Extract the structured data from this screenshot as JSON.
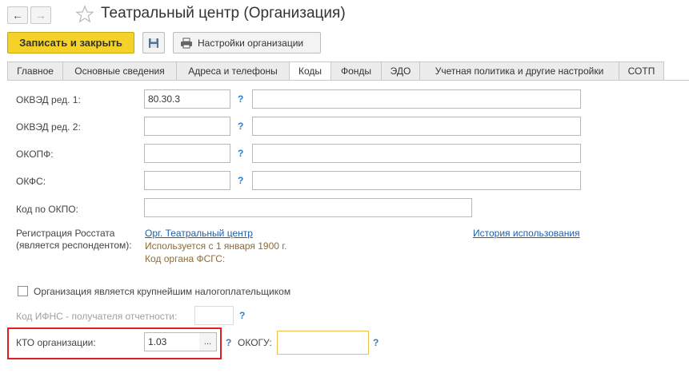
{
  "window": {
    "title": "Театральный центр (Организация)"
  },
  "toolbar": {
    "save_close_label": "Записать и закрыть",
    "settings_label": "Настройки организации"
  },
  "tabs": [
    {
      "label": "Главное"
    },
    {
      "label": "Основные сведения"
    },
    {
      "label": "Адреса и телефоны"
    },
    {
      "label": "Коды",
      "active": true
    },
    {
      "label": "Фонды"
    },
    {
      "label": "ЭДО"
    },
    {
      "label": "Учетная политика и другие настройки"
    },
    {
      "label": "СОТП"
    }
  ],
  "form": {
    "okved1": {
      "label": "ОКВЭД ред. 1:",
      "value": "80.30.3"
    },
    "okved2": {
      "label": "ОКВЭД ред. 2:",
      "value": ""
    },
    "okopf": {
      "label": "ОКОПФ:",
      "value": ""
    },
    "okfs": {
      "label": "ОКФС:",
      "value": ""
    },
    "okpo": {
      "label": "Код по ОКПО:",
      "value": ""
    },
    "rosstat": {
      "label_line1": "Регистрация Росстата",
      "label_line2": "(является респондентом):",
      "org_link": "Орг. Театральный центр",
      "used_since": "Используется с 1 января 1900 г.",
      "fsgs_code": "Код органа ФСГС:",
      "history_link": "История использования"
    },
    "largest_taxpayer": {
      "label": "Организация является крупнейшим налогоплательщиком",
      "checked": false
    },
    "ifns_code": {
      "label": "Код ИФНС - получателя отчетности:",
      "value": ""
    },
    "kto": {
      "label": "КТО организации:",
      "value": "1.03"
    },
    "okogu": {
      "label": "ОКОГУ:",
      "value": ""
    },
    "help_mark": "?",
    "ellipsis": "..."
  },
  "colors": {
    "accent_yellow": "#f5d22a",
    "highlight_red": "#e02020",
    "link_blue": "#1f5fa8",
    "help_blue": "#2d7bc4"
  }
}
